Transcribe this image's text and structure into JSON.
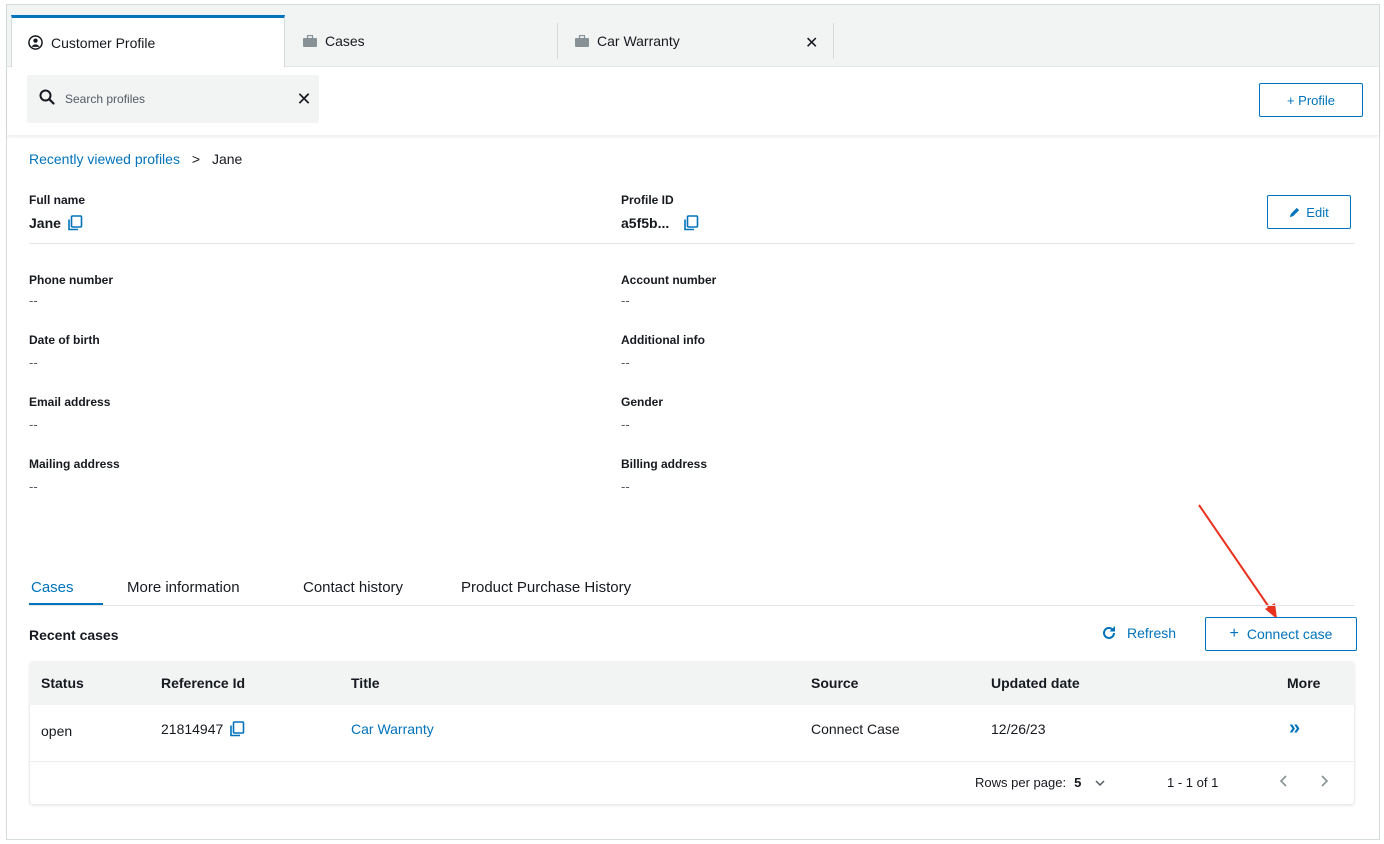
{
  "tabs": [
    {
      "label": "Customer Profile",
      "icon": "user-circle-icon"
    },
    {
      "label": "Cases",
      "icon": "briefcase-icon"
    },
    {
      "label": "Car Warranty",
      "icon": "briefcase-icon"
    }
  ],
  "search": {
    "placeholder": "Search profiles"
  },
  "add_profile_label": "+ Profile",
  "breadcrumb": {
    "parent": "Recently viewed profiles",
    "sep": ">",
    "current": "Jane"
  },
  "profile": {
    "full_name_label": "Full name",
    "full_name": "Jane",
    "profile_id_label": "Profile ID",
    "profile_id": "a5f5b...",
    "edit_label": "Edit",
    "fields": [
      {
        "label": "Phone number",
        "value": "--"
      },
      {
        "label": "Account number",
        "value": "--"
      },
      {
        "label": "Date of birth",
        "value": "--"
      },
      {
        "label": "Additional info",
        "value": "--"
      },
      {
        "label": "Email address",
        "value": "--"
      },
      {
        "label": "Gender",
        "value": "--"
      },
      {
        "label": "Mailing address",
        "value": "--"
      },
      {
        "label": "Billing address",
        "value": "--"
      }
    ]
  },
  "subtabs": [
    "Cases",
    "More information",
    "Contact history",
    "Product Purchase History"
  ],
  "cases": {
    "title": "Recent cases",
    "refresh_label": "Refresh",
    "connect_label": "Connect case",
    "columns": [
      "Status",
      "Reference Id",
      "Title",
      "Source",
      "Updated date",
      "More"
    ],
    "rows": [
      {
        "status": "open",
        "reference_id": "21814947",
        "title": "Car Warranty",
        "source": "Connect Case",
        "updated": "12/26/23",
        "more": "»"
      }
    ],
    "rows_per_page_label": "Rows per page:",
    "rows_per_page": "5",
    "range": "1 - 1 of 1"
  },
  "colors": {
    "accent": "#0073bb",
    "annotation_arrow": "#e8321e"
  }
}
